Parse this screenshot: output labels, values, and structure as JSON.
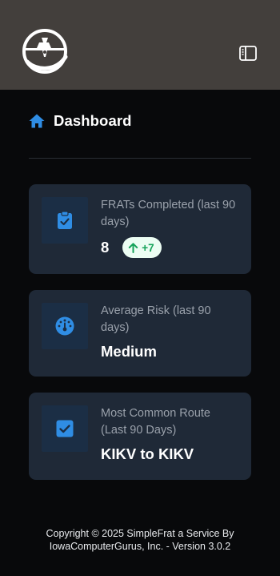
{
  "header": {
    "logo_icon": "airplane-logo-icon",
    "sidebar_toggle_icon": "sidebar-toggle-icon"
  },
  "page": {
    "title": "Dashboard",
    "title_icon": "home-icon"
  },
  "cards": [
    {
      "label": "FRATs Completed (last 90 days)",
      "value": "8",
      "change": "+7",
      "change_icon": "arrow-up-icon",
      "icon": "clipboard-check-icon"
    },
    {
      "label": "Average Risk (last 90 days)",
      "value": "Medium",
      "icon": "gauge-icon"
    },
    {
      "label": "Most Common Route (Last 90 Days)",
      "value": "KIKV to KIKV",
      "icon": "checkbox-icon"
    }
  ],
  "footer": {
    "line1": "Copyright © 2025 SimpleFrat a Service By",
    "line2": "IowaComputerGurus, Inc. - Version 3.0.2"
  },
  "colors": {
    "header_bg": "#433f3c",
    "page_bg": "#08090b",
    "card_bg": "#1f2937",
    "accent": "#2f8de4",
    "badge_bg": "#ecfdf3",
    "badge_text": "#16a35a"
  }
}
